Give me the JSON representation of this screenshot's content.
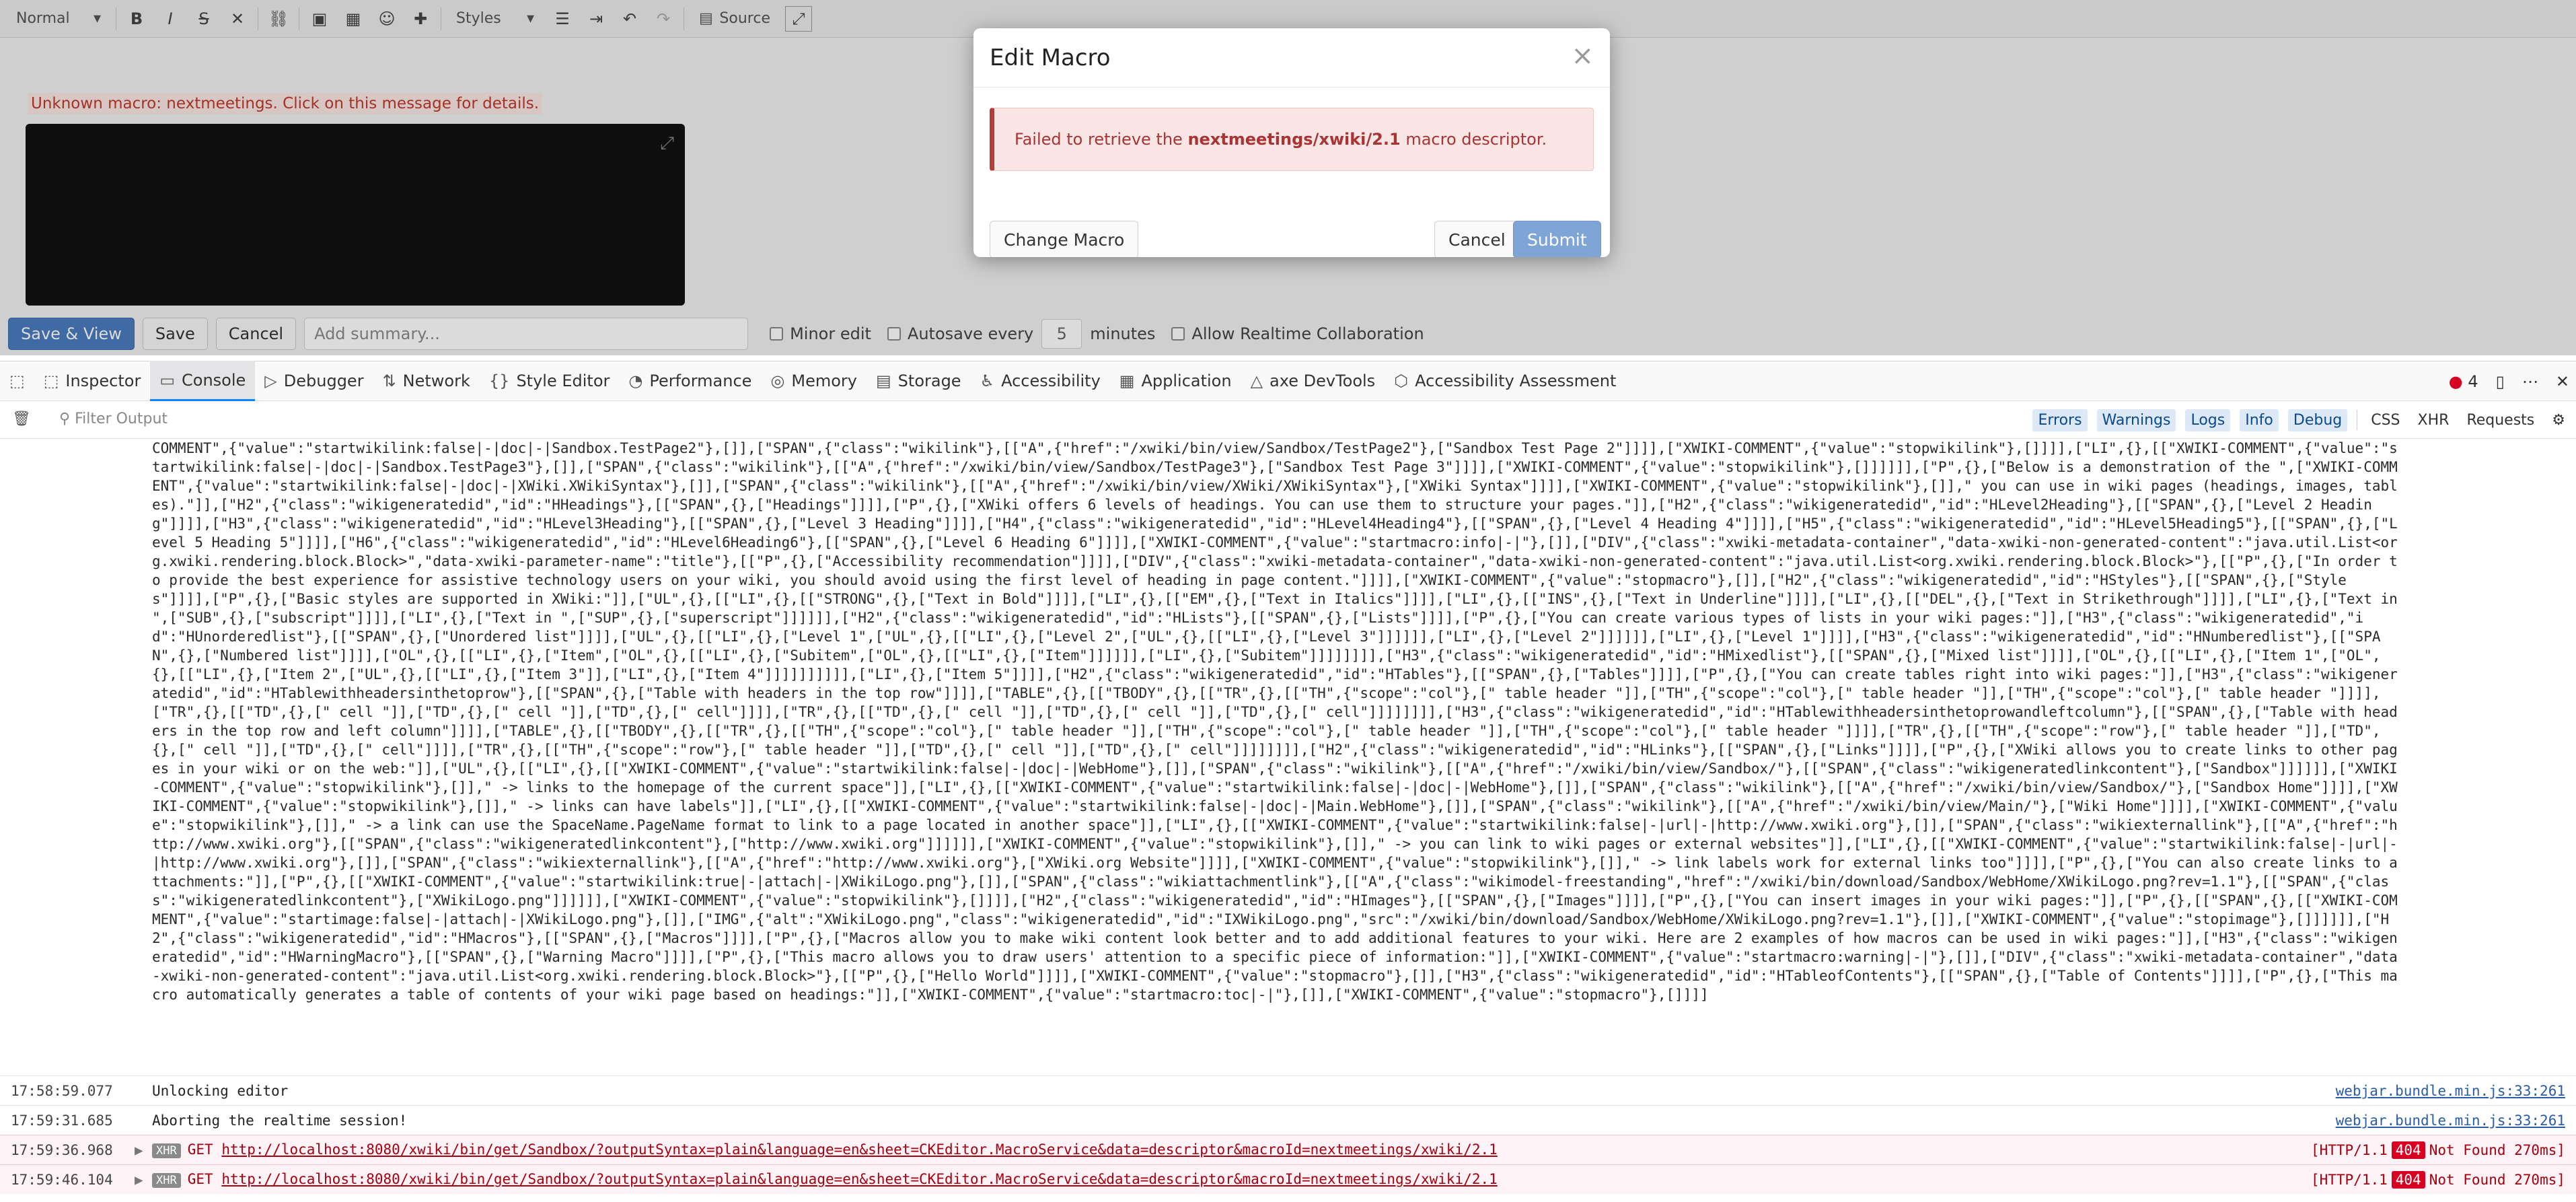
{
  "editor": {
    "toolbar": {
      "format_select": "Normal",
      "styles_select": "Styles",
      "source_label": "Source"
    },
    "warning": "Unknown macro: nextmeetings. Click on this message for details.",
    "actions": {
      "save_view": "Save & View",
      "save": "Save",
      "cancel": "Cancel",
      "summary_placeholder": "Add summary...",
      "minor_edit": "Minor edit",
      "autosave_label": "Autosave every",
      "autosave_value": "5",
      "autosave_unit": "minutes",
      "realtime": "Allow Realtime Collaboration"
    }
  },
  "modal": {
    "title": "Edit Macro",
    "alert_prefix": "Failed to retrieve the ",
    "alert_macro": "nextmeetings/xwiki/2.1",
    "alert_suffix": " macro descriptor.",
    "change_label": "Change Macro",
    "cancel_label": "Cancel",
    "submit_label": "Submit"
  },
  "devtools": {
    "tabs": [
      {
        "label": "Inspector",
        "icon": "inspector-icon"
      },
      {
        "label": "Console",
        "icon": "console-icon"
      },
      {
        "label": "Debugger",
        "icon": "debugger-icon"
      },
      {
        "label": "Network",
        "icon": "network-icon"
      },
      {
        "label": "Style Editor",
        "icon": "style-editor-icon"
      },
      {
        "label": "Performance",
        "icon": "performance-icon"
      },
      {
        "label": "Memory",
        "icon": "memory-icon"
      },
      {
        "label": "Storage",
        "icon": "storage-icon"
      },
      {
        "label": "Accessibility",
        "icon": "accessibility-icon"
      },
      {
        "label": "Application",
        "icon": "application-icon"
      },
      {
        "label": "axe DevTools",
        "icon": "axe-icon"
      },
      {
        "label": "Accessibility Assessment",
        "icon": "assessment-icon"
      }
    ],
    "error_count": "4",
    "filter_placeholder": "Filter Output",
    "levels": [
      "Errors",
      "Warnings",
      "Logs",
      "Info",
      "Debug"
    ],
    "extra": [
      "CSS",
      "XHR",
      "Requests"
    ]
  },
  "console": {
    "json_text": "COMMENT\",{\"value\":\"startwikilink:false|-|doc|-|Sandbox.TestPage2\"},[]],[\"SPAN\",{\"class\":\"wikilink\"},[[\"A\",{\"href\":\"/xwiki/bin/view/Sandbox/TestPage2\"},[\"Sandbox Test Page 2\"]]]],[\"XWIKI-COMMENT\",{\"value\":\"stopwikilink\"},[]]]],[\"LI\",{},[[\"XWIKI-COMMENT\",{\"value\":\"startwikilink:false|-|doc|-|Sandbox.TestPage3\"},[]],[\"SPAN\",{\"class\":\"wikilink\"},[[\"A\",{\"href\":\"/xwiki/bin/view/Sandbox/TestPage3\"},[\"Sandbox Test Page 3\"]]]],[\"XWIKI-COMMENT\",{\"value\":\"stopwikilink\"},[]]]]]],[\"P\",{},[\"Below is a demonstration of the \",[\"XWIKI-COMMENT\",{\"value\":\"startwikilink:false|-|doc|-|XWiki.XWikiSyntax\"},[]],[\"SPAN\",{\"class\":\"wikilink\"},[[\"A\",{\"href\":\"/xwiki/bin/view/XWiki/XWikiSyntax\"},[\"XWiki Syntax\"]]]],[\"XWIKI-COMMENT\",{\"value\":\"stopwikilink\"},[]],\" you can use in wiki pages (headings, images, tables).\"]],[\"H2\",{\"class\":\"wikigeneratedid\",\"id\":\"HHeadings\"},[[\"SPAN\",{},[\"Headings\"]]]],[\"P\",{},[\"XWiki offers 6 levels of headings. You can use them to structure your pages.\"]],[\"H2\",{\"class\":\"wikigeneratedid\",\"id\":\"HLevel2Heading\"},[[\"SPAN\",{},[\"Level 2 Heading\"]]]],[\"H3\",{\"class\":\"wikigeneratedid\",\"id\":\"HLevel3Heading\"},[[\"SPAN\",{},[\"Level 3 Heading\"]]]],[\"H4\",{\"class\":\"wikigeneratedid\",\"id\":\"HLevel4Heading4\"},[[\"SPAN\",{},[\"Level 4 Heading 4\"]]]],[\"H5\",{\"class\":\"wikigeneratedid\",\"id\":\"HLevel5Heading5\"},[[\"SPAN\",{},[\"Level 5 Heading 5\"]]]],[\"H6\",{\"class\":\"wikigeneratedid\",\"id\":\"HLevel6Heading6\"},[[\"SPAN\",{},[\"Level 6 Heading 6\"]]]],[\"XWIKI-COMMENT\",{\"value\":\"startmacro:info|-|\"},[]],[\"DIV\",{\"class\":\"xwiki-metadata-container\",\"data-xwiki-non-generated-content\":\"java.util.List<org.xwiki.rendering.block.Block>\",\"data-xwiki-parameter-name\":\"title\"},[[\"P\",{},[\"Accessibility recommendation\"]]]],[\"DIV\",{\"class\":\"xwiki-metadata-container\",\"data-xwiki-non-generated-content\":\"java.util.List<org.xwiki.rendering.block.Block>\"},[[\"P\",{},[\"In order to provide the best experience for assistive technology users on your wiki, you should avoid using the first level of heading in page content.\"]]]],[\"XWIKI-COMMENT\",{\"value\":\"stopmacro\"},[]],[\"H2\",{\"class\":\"wikigeneratedid\",\"id\":\"HStyles\"},[[\"SPAN\",{},[\"Styles\"]]]],[\"P\",{},[\"Basic styles are supported in XWiki:\"]],[\"UL\",{},[[\"LI\",{},[[\"STRONG\",{},[\"Text in Bold\"]]]],[\"LI\",{},[[\"EM\",{},[\"Text in Italics\"]]]],[\"LI\",{},[[\"INS\",{},[\"Text in Underline\"]]]],[\"LI\",{},[[\"DEL\",{},[\"Text in Strikethrough\"]]]],[\"LI\",{},[\"Text in \",[\"SUB\",{},[\"subscript\"]]]],[\"LI\",{},[\"Text in \",[\"SUP\",{},[\"superscript\"]]]]]],[\"H2\",{\"class\":\"wikigeneratedid\",\"id\":\"HLists\"},[[\"SPAN\",{},[\"Lists\"]]]],[\"P\",{},[\"You can create various types of lists in your wiki pages:\"]],[\"H3\",{\"class\":\"wikigeneratedid\",\"id\":\"HUnorderedlist\"},[[\"SPAN\",{},[\"Unordered list\"]]]],[\"UL\",{},[[\"LI\",{},[\"Level 1\",[\"UL\",{},[[\"LI\",{},[\"Level 2\",[\"UL\",{},[[\"LI\",{},[\"Level 3\"]]]]]],[\"LI\",{},[\"Level 2\"]]]]]],[\"LI\",{},[\"Level 1\"]]]],[\"H3\",{\"class\":\"wikigeneratedid\",\"id\":\"HNumberedlist\"},[[\"SPAN\",{},[\"Numbered list\"]]]],[\"OL\",{},[[\"LI\",{},[\"Item\",[\"OL\",{},[[\"LI\",{},[\"Subitem\",[\"OL\",{},[[\"LI\",{},[\"Item\"]]]]]],[\"LI\",{},[\"Subitem\"]]]]]]]],[\"H3\",{\"class\":\"wikigeneratedid\",\"id\":\"HMixedlist\"},[[\"SPAN\",{},[\"Mixed list\"]]]],[\"OL\",{},[[\"LI\",{},[\"Item 1\",[\"OL\",{},[[\"LI\",{},[\"Item 2\",[\"UL\",{},[[\"LI\",{},[\"Item 3\"]],[\"LI\",{},[\"Item 4\"]]]]]]]]]],[\"LI\",{},[\"Item 5\"]]]],[\"H2\",{\"class\":\"wikigeneratedid\",\"id\":\"HTables\"},[[\"SPAN\",{},[\"Tables\"]]]],[\"P\",{},[\"You can create tables right into wiki pages:\"]],[\"H3\",{\"class\":\"wikigeneratedid\",\"id\":\"HTablewithheadersinthetoprow\"},[[\"SPAN\",{},[\"Table with headers in the top row\"]]]],[\"TABLE\",{},[[\"TBODY\",{},[[\"TR\",{},[[\"TH\",{\"scope\":\"col\"},[\" table header \"]],[\"TH\",{\"scope\":\"col\"},[\" table header \"]],[\"TH\",{\"scope\":\"col\"},[\" table header \"]]]],[\"TR\",{},[[\"TD\",{},[\" cell \"]],[\"TD\",{},[\" cell \"]],[\"TD\",{},[\" cell\"]]]],[\"TR\",{},[[\"TD\",{},[\" cell \"]],[\"TD\",{},[\" cell \"]],[\"TD\",{},[\" cell\"]]]]]]]],[\"H3\",{\"class\":\"wikigeneratedid\",\"id\":\"HTablewithheadersinthetoprowandleftcolumn\"},[[\"SPAN\",{},[\"Table with headers in the top row and left column\"]]]],[\"TABLE\",{},[[\"TBODY\",{},[[\"TR\",{},[[\"TH\",{\"scope\":\"col\"},[\" table header \"]],[\"TH\",{\"scope\":\"col\"},[\" table header \"]],[\"TH\",{\"scope\":\"col\"},[\" table header \"]]]],[\"TR\",{},[[\"TH\",{\"scope\":\"row\"},[\" table header \"]],[\"TD\",{},[\" cell \"]],[\"TD\",{},[\" cell\"]]]],[\"TR\",{},[[\"TH\",{\"scope\":\"row\"},[\" table header \"]],[\"TD\",{},[\" cell \"]],[\"TD\",{},[\" cell\"]]]]]]]],[\"H2\",{\"class\":\"wikigeneratedid\",\"id\":\"HLinks\"},[[\"SPAN\",{},[\"Links\"]]]],[\"P\",{},[\"XWiki allows you to create links to other pages in your wiki or on the web:\"]],[\"UL\",{},[[\"LI\",{},[[\"XWIKI-COMMENT\",{\"value\":\"startwikilink:false|-|doc|-|WebHome\"},[]],[\"SPAN\",{\"class\":\"wikilink\"},[[\"A\",{\"href\":\"/xwiki/bin/view/Sandbox/\"},[[\"SPAN\",{\"class\":\"wikigeneratedlinkcontent\"},[\"Sandbox\"]]]]]],[\"XWIKI-COMMENT\",{\"value\":\"stopwikilink\"},[]],\" -> links to the homepage of the current space\"]],[\"LI\",{},[[\"XWIKI-COMMENT\",{\"value\":\"startwikilink:false|-|doc|-|WebHome\"},[]],[\"SPAN\",{\"class\":\"wikilink\"},[[\"A\",{\"href\":\"/xwiki/bin/view/Sandbox/\"},[\"Sandbox Home\"]]]],[\"XWIKI-COMMENT\",{\"value\":\"stopwikilink\"},[]],\" -> links can have labels\"]],[\"LI\",{},[[\"XWIKI-COMMENT\",{\"value\":\"startwikilink:false|-|doc|-|Main.WebHome\"},[]],[\"SPAN\",{\"class\":\"wikilink\"},[[\"A\",{\"href\":\"/xwiki/bin/view/Main/\"},[\"Wiki Home\"]]]],[\"XWIKI-COMMENT\",{\"value\":\"stopwikilink\"},[]],\" -> a link can use the SpaceName.PageName format to link to a page located in another space\"]],[\"LI\",{},[[\"XWIKI-COMMENT\",{\"value\":\"startwikilink:false|-|url|-|http://www.xwiki.org\"},[]],[\"SPAN\",{\"class\":\"wikiexternallink\"},[[\"A\",{\"href\":\"http://www.xwiki.org\"},[[\"SPAN\",{\"class\":\"wikigeneratedlinkcontent\"},[\"http://www.xwiki.org\"]]]]]],[\"XWIKI-COMMENT\",{\"value\":\"stopwikilink\"},[]],\" -> you can link to wiki pages or external websites\"]],[\"LI\",{},[[\"XWIKI-COMMENT\",{\"value\":\"startwikilink:false|-|url|-|http://www.xwiki.org\"},[]],[\"SPAN\",{\"class\":\"wikiexternallink\"},[[\"A\",{\"href\":\"http://www.xwiki.org\"},[\"XWiki.org Website\"]]]],[\"XWIKI-COMMENT\",{\"value\":\"stopwikilink\"},[]],\" -> link labels work for external links too\"]]]],[\"P\",{},[\"You can also create links to attachments:\"]],[\"P\",{},[[\"XWIKI-COMMENT\",{\"value\":\"startwikilink:true|-|attach|-|XWikiLogo.png\"},[]],[\"SPAN\",{\"class\":\"wikiattachmentlink\"},[[\"A\",{\"class\":\"wikimodel-freestanding\",\"href\":\"/xwiki/bin/download/Sandbox/WebHome/XWikiLogo.png?rev=1.1\"},[[\"SPAN\",{\"class\":\"wikigeneratedlinkcontent\"},[\"XWikiLogo.png\"]]]]]],[\"XWIKI-COMMENT\",{\"value\":\"stopwikilink\"},[]]]],[\"H2\",{\"class\":\"wikigeneratedid\",\"id\":\"HImages\"},[[\"SPAN\",{},[\"Images\"]]]],[\"P\",{},[\"You can insert images in your wiki pages:\"]],[\"P\",{},[[\"SPAN\",{},[[\"XWIKI-COMMENT\",{\"value\":\"startimage:false|-|attach|-|XWikiLogo.png\"},[]],[\"IMG\",{\"alt\":\"XWikiLogo.png\",\"class\":\"wikigeneratedid\",\"id\":\"IXWikiLogo.png\",\"src\":\"/xwiki/bin/download/Sandbox/WebHome/XWikiLogo.png?rev=1.1\"},[]],[\"XWIKI-COMMENT\",{\"value\":\"stopimage\"},[]]]]]],[\"H2\",{\"class\":\"wikigeneratedid\",\"id\":\"HMacros\"},[[\"SPAN\",{},[\"Macros\"]]]],[\"P\",{},[\"Macros allow you to make wiki content look better and to add additional features to your wiki. Here are 2 examples of how macros can be used in wiki pages:\"]],[\"H3\",{\"class\":\"wikigeneratedid\",\"id\":\"HWarningMacro\"},[[\"SPAN\",{},[\"Warning Macro\"]]]],[\"P\",{},[\"This macro allows you to draw users' attention to a specific piece of information:\"]],[\"XWIKI-COMMENT\",{\"value\":\"startmacro:warning|-|\"},[]],[\"DIV\",{\"class\":\"xwiki-metadata-container\",\"data-xwiki-non-generated-content\":\"java.util.List<org.xwiki.rendering.block.Block>\"},[[\"P\",{},[\"Hello World\"]]]],[\"XWIKI-COMMENT\",{\"value\":\"stopmacro\"},[]],[\"H3\",{\"class\":\"wikigeneratedid\",\"id\":\"HTableofContents\"},[[\"SPAN\",{},[\"Table of Contents\"]]]],[\"P\",{},[\"This macro automatically generates a table of contents of your wiki page based on headings:\"]],[\"XWIKI-COMMENT\",{\"value\":\"startmacro:toc|-|\"},[]],[\"XWIKI-COMMENT\",{\"value\":\"stopmacro\"},[]]]]",
    "rows": [
      {
        "time": "17:58:59.077",
        "message": "Unlocking editor",
        "source": "webjar.bundle.min.js:33:261"
      },
      {
        "time": "17:59:31.685",
        "message": "Aborting the realtime session!",
        "source": "webjar.bundle.min.js:33:261"
      }
    ],
    "requests": [
      {
        "time": "17:59:36.968",
        "method": "GET",
        "url": "http://localhost:8080/xwiki/bin/get/Sandbox/?outputSyntax=plain&language=en&sheet=CKEditor.MacroService&data=descriptor&macroId=nextmeetings/xwiki/2.1",
        "proto": "[HTTP/1.1",
        "code": "404",
        "status": "Not Found 270ms]"
      },
      {
        "time": "17:59:46.104",
        "method": "GET",
        "url": "http://localhost:8080/xwiki/bin/get/Sandbox/?outputSyntax=plain&language=en&sheet=CKEditor.MacroService&data=descriptor&macroId=nextmeetings/xwiki/2.1",
        "proto": "[HTTP/1.1",
        "code": "404",
        "status": "Not Found 270ms]"
      }
    ],
    "xhr_badge": "XHR"
  }
}
